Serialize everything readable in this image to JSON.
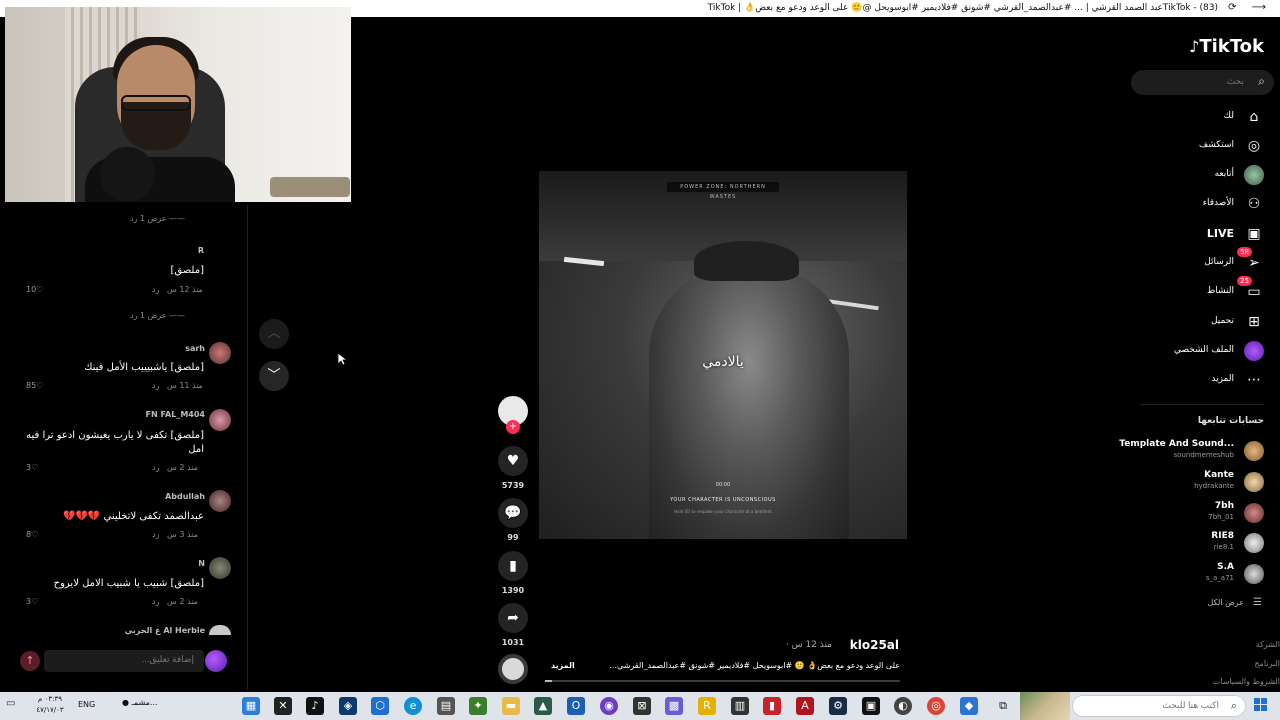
{
  "window": {
    "title": "TikTok - (83)عبد الصمد القرشي | ... #عبدالصمد_القرشي #شونق #فلاديمير #ابوسويحل @🙂 على الوعد ودعو مع بعض👌 | TikTok"
  },
  "comments": {
    "items": [
      {
        "reply_toggle": "عرض 1 رد ——",
        "user": "R",
        "text": "[ملصق]",
        "time": "منذ 12 س",
        "reply": "رد",
        "likes": "10"
      },
      {
        "reply_toggle": "عرض 1 رد ——",
        "user": "sarh",
        "text": "[ملصق] ياشبيييب الأمل فينك",
        "time": "منذ 11 س",
        "reply": "رد",
        "likes": "85"
      },
      {
        "user": "FN FAL_M404",
        "text": "[ملصق] تكفى لا يارب يعيشون ادعو ترا فيه امل",
        "time": "منذ 2 س",
        "reply": "رد",
        "likes": "3"
      },
      {
        "user": "Abdullah",
        "text": "عبدالصمد تكفى لاتخليني 💔💔💔",
        "time": "منذ 3 س",
        "reply": "رد",
        "likes": "8"
      },
      {
        "user": "N",
        "text": "[ملصق] شبيب يا شبيب الامل لايروح",
        "time": "منذ 2 س",
        "reply": "رد",
        "likes": "3"
      },
      {
        "user": "Al Herbie غ الحربي"
      }
    ],
    "input_placeholder": "إضافة تعليق..."
  },
  "video": {
    "caption": "يالادمي",
    "hud_top": "POWER ZONE: NORTHERN WASTES",
    "hud_time": "00:00",
    "hud_main": "YOUR CHARACTER IS UNCONSCIOUS",
    "hud_sub": "Hold [E] to respawn your character at a bed/tent"
  },
  "rail": {
    "likes": "5739",
    "comments": "99",
    "saves": "1390",
    "shares": "1031"
  },
  "post": {
    "author": "klo25al",
    "time": "منذ 12 س ·",
    "description": "على الوعد ودعو مع بعض👌 🙂 #ابوسويحل #فلاديمير #شونق #عبدالصمد_القرشي...",
    "more": "المزيد",
    "progress": 0.02
  },
  "sidebar": {
    "logo": "TikTok",
    "search_placeholder": "بحث",
    "nav": [
      {
        "label": "لك",
        "icon": "home-icon"
      },
      {
        "label": "استكشف",
        "icon": "compass-icon"
      },
      {
        "label": "أتابعه",
        "icon": "avatar"
      },
      {
        "label": "الأصدقاء",
        "icon": "friends-icon"
      },
      {
        "label": "LIVE",
        "icon": "live-icon"
      },
      {
        "label": "الرسائل",
        "icon": "messages-icon",
        "badge": "58"
      },
      {
        "label": "النشاط",
        "icon": "activity-icon",
        "badge": "25"
      },
      {
        "label": "تحميل",
        "icon": "upload-icon"
      },
      {
        "label": "الملف الشخصي",
        "icon": "profile-avatar"
      },
      {
        "label": "المزيد",
        "icon": "more-icon"
      }
    ],
    "following_title": "حسابات تتابعها",
    "accounts": [
      {
        "name": "Template And Sound...",
        "handle": "soundmemeshub"
      },
      {
        "name": "Kante",
        "handle": "hydrakante"
      },
      {
        "name": "7bh",
        "handle": "7bh_01"
      },
      {
        "name": "RIE8",
        "handle": "rie8.1"
      },
      {
        "name": "S.A",
        "handle": "s_a_a71"
      }
    ],
    "see_all": "عرض الكل",
    "footer": [
      "الشركة",
      "البرنامج",
      "الشروط والسياسات"
    ]
  },
  "taskbar": {
    "search_placeholder": "اكتب هنا للبحث",
    "lang": "ENG",
    "clock_time": "٠٣:٣٩ م",
    "clock_date": "٤٧/١٧/٠٣",
    "weather": "مشمـ..."
  }
}
